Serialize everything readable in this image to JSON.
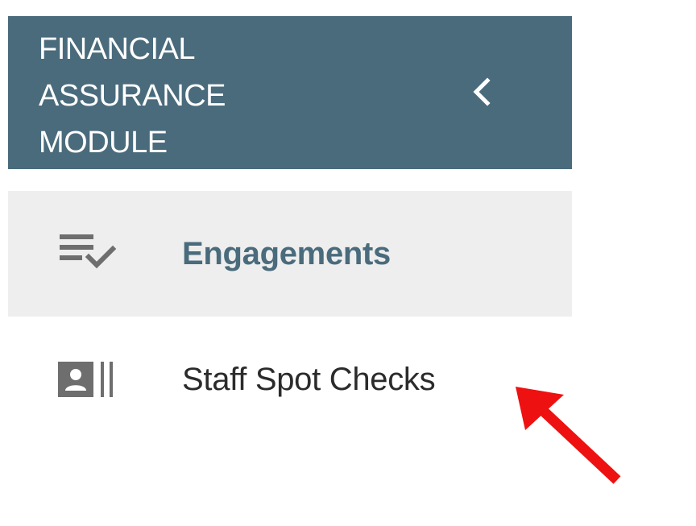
{
  "sidebar": {
    "header": {
      "title": "FINANCIAL\nASSURANCE\nMODULE",
      "collapse_icon": "chevron-left-icon"
    },
    "items": [
      {
        "label": "Engagements",
        "icon": "checklist-icon",
        "active": true
      },
      {
        "label": "Staff Spot Checks",
        "icon": "contact-card-icon",
        "active": false
      }
    ]
  },
  "colors": {
    "header_bg": "#4a6b7c",
    "active_bg": "#eeeeee",
    "active_text": "#4a6b7c",
    "icon_gray": "#6e6e6e",
    "annotation_arrow": "#ee1111"
  }
}
